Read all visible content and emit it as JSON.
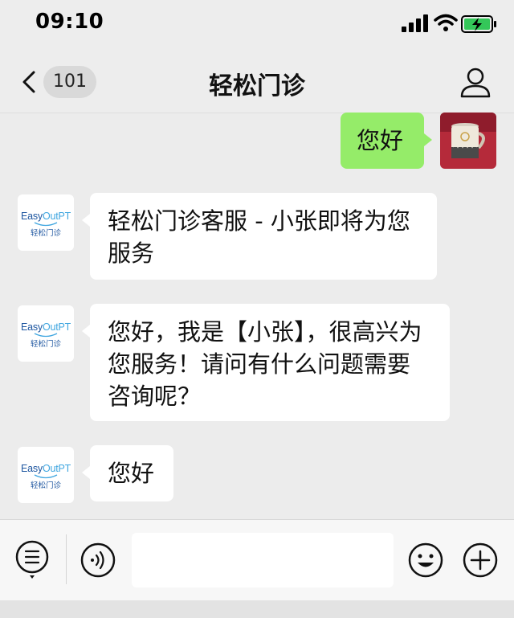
{
  "status_bar": {
    "time": "09:10",
    "icons": [
      "signal-icon",
      "wifi-icon",
      "battery-charging-icon"
    ]
  },
  "header": {
    "title": "轻松门诊",
    "unread_count": "101",
    "icons": [
      "back-chevron-icon",
      "profile-icon"
    ]
  },
  "messages": [
    {
      "sender": "self",
      "text": "您好"
    },
    {
      "sender": "bot",
      "text": "轻松门诊客服 - 小张即将为您服务"
    },
    {
      "sender": "bot",
      "text": "您好，我是【小张】，很高兴为您服务！请问有什么问题需要咨询呢？"
    },
    {
      "sender": "bot",
      "text": "您好"
    }
  ],
  "bot_avatar": {
    "brand_prefix": "Easy",
    "brand_suffix": "OutPT",
    "brand_cn": "轻松门诊"
  },
  "input_bar": {
    "placeholder": "",
    "icons": [
      "menu-icon",
      "voice-icon",
      "emoji-icon",
      "plus-icon"
    ]
  },
  "colors": {
    "self_bubble": "#95ec69",
    "bot_bubble": "#ffffff",
    "background": "#ececec",
    "brand_blue": "#1e56a0",
    "brand_accent": "#3fa6e0"
  }
}
